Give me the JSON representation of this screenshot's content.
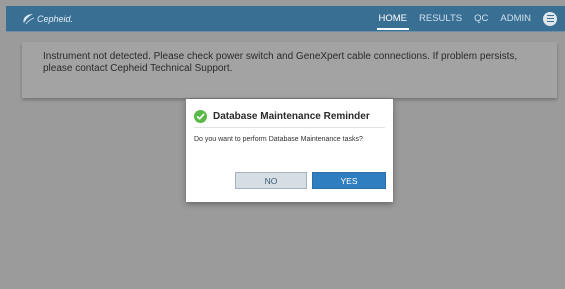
{
  "app": {
    "logo_text": "Cepheid.",
    "nav": {
      "items": [
        {
          "label": "HOME",
          "active": true
        },
        {
          "label": "RESULTS",
          "active": false
        },
        {
          "label": "QC",
          "active": false
        },
        {
          "label": "ADMIN",
          "active": false
        }
      ],
      "menu_icon": "hamburger-menu-icon"
    },
    "colors": {
      "topbar": "#3a6f94",
      "primary_button": "#2e7ec0",
      "overlay": "#9b9b9b",
      "success": "#59b847"
    }
  },
  "banner": {
    "message": "Instrument not detected. Please check power switch and GeneXpert cable connections. If problem persists, please contact Cepheid Technical Support."
  },
  "dialog": {
    "icon": "check-circle-icon",
    "title": "Database Maintenance Reminder",
    "message": "Do you want to perform Database Maintenance tasks?",
    "buttons": {
      "no": "NO",
      "yes": "YES"
    }
  }
}
